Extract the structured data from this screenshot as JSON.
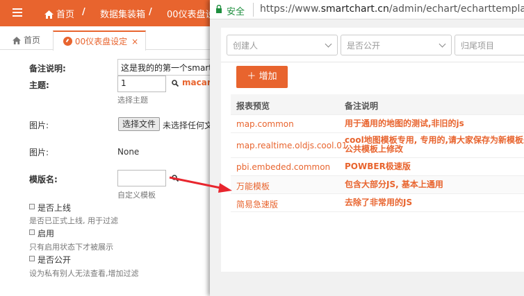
{
  "admin": {
    "breadcrumb": [
      "首页",
      "数据集装箱",
      "00仪表盘设"
    ],
    "tabs": {
      "home_label": "首页",
      "active_label": "00仪表盘设定",
      "close_glyph": "×"
    },
    "form": {
      "remark_label": "备注说明:",
      "remark_value": "这是我的的第一个smartc",
      "theme_label": "主题:",
      "theme_value": "1",
      "theme_link": "macaro",
      "theme_hint": "选择主题",
      "image_label": "图片:",
      "file_button": "选择文件",
      "file_status": "未选择任何文",
      "image_label2": "图片:",
      "image_value": "None",
      "template_label": "模版名:",
      "template_value": "",
      "template_hint": "自定义模板",
      "online_label": "是否上线",
      "online_hint": "是否已正式上线, 用于过滤",
      "enabled_label": "启用",
      "enabled_hint": "只有启用状态下才被展示",
      "public_label": "是否公开",
      "public_hint": "设为私有别人无法查看,增加过滤"
    }
  },
  "popup": {
    "secure_label": "安全",
    "url_prefix": "https://www.",
    "url_domain": "smartchart.cn",
    "url_path": "/admin/echart/echarttemplate",
    "filters": {
      "creator_placeholder": "创建人",
      "public_placeholder": "是否公开",
      "project_placeholder": "归尾项目"
    },
    "add_button": "增加",
    "table": {
      "headers": [
        "报表预览",
        "备注说明"
      ],
      "rows": [
        {
          "name": "map.common",
          "remark": "用于通用的地图的测试,非旧的js",
          "remark2": ""
        },
        {
          "name": "map.realtime.oldjs.cool.01",
          "remark": "cool地图模板专用, 专用的,请大家保存为新模板差",
          "remark2": "公共模板上修改"
        },
        {
          "name": "pbi.embeded.common",
          "remark": "POWBER极速版",
          "remark2": ""
        },
        {
          "name": "万能模板",
          "remark": "包含大部分JS, 基本上通用",
          "remark2": ""
        },
        {
          "name": "简易急速版",
          "remark": "去除了非常用的JS",
          "remark2": ""
        }
      ]
    }
  },
  "colors": {
    "accent": "#e8642e",
    "secure_green": "#1e8e3e",
    "arrow_red": "#e8262e"
  }
}
